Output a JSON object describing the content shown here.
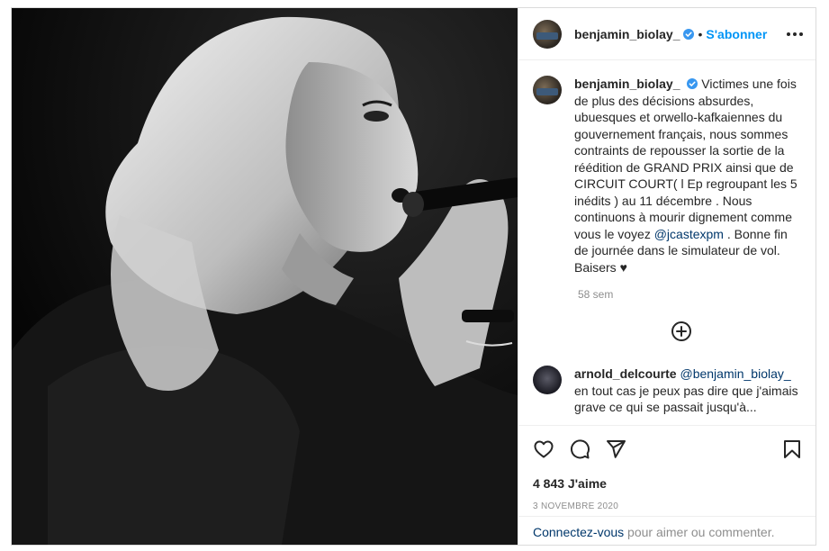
{
  "post": {
    "author": {
      "username": "benjamin_biolay_",
      "verified": true,
      "avatar": "avatar-image"
    },
    "header": {
      "separator": "•",
      "subscribe_label": "S'abonner",
      "more_icon": "more-options-icon"
    },
    "caption": {
      "username": "benjamin_biolay_",
      "text_before_mention": "Victimes une fois de plus des décisions absurdes, ubuesques et orwello-kafkaiennes du gouvernement français, nous sommes contraints de repousser la sortie de la réédition de GRAND PRIX ainsi que de CIRCUIT COURT( l Ep regroupant les 5 inédits ) au 11 décembre . Nous continuons à mourir dignement comme vous le voyez ",
      "mention": "@jcastexpm",
      "text_after_mention": " . Bonne fin de journée dans le simulateur de vol. Baisers ",
      "emoji": "♥",
      "time": "58 sem"
    },
    "load_more_icon": "plus-circle-icon",
    "comments": [
      {
        "username": "arnold_delcourte",
        "mention": "@benjamin_biolay_",
        "text": " en tout cas je peux pas dire que j'aimais grave ce qui se passait jusqu'à..."
      }
    ],
    "actions": {
      "like_icon": "heart-icon",
      "comment_icon": "comment-icon",
      "share_icon": "share-icon",
      "save_icon": "bookmark-icon"
    },
    "likes": "4 843 J'aime",
    "date": "3 NOVEMBRE 2020",
    "login": {
      "link": "Connectez-vous",
      "text": " pour aimer ou commenter."
    },
    "colors": {
      "accent": "#0095f6",
      "mention": "#00376b",
      "muted": "#8e8e8e",
      "text": "#262626"
    }
  }
}
